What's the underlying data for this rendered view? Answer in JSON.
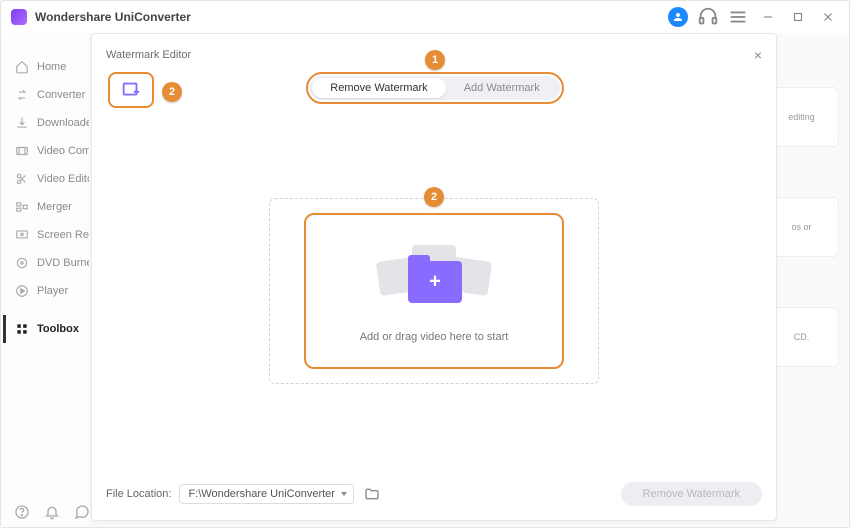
{
  "app": {
    "title": "Wondershare UniConverter"
  },
  "titlebar_icons": {
    "avatar": "user-avatar",
    "support": "headset-icon",
    "menu": "hamburger-icon",
    "minimize": "minimize-icon",
    "maximize": "maximize-icon",
    "close": "close-icon"
  },
  "sidebar": {
    "items": [
      {
        "label": "Home"
      },
      {
        "label": "Converter"
      },
      {
        "label": "Downloader"
      },
      {
        "label": "Video Compressor"
      },
      {
        "label": "Video Editor"
      },
      {
        "label": "Merger"
      },
      {
        "label": "Screen Recorder"
      },
      {
        "label": "DVD Burner"
      },
      {
        "label": "Player"
      },
      {
        "label": "Toolbox"
      }
    ],
    "active_index": 9
  },
  "background_cards": [
    {
      "text": "editing"
    },
    {
      "text": "os or"
    },
    {
      "text": "CD."
    }
  ],
  "modal": {
    "title": "Watermark Editor",
    "close": "×",
    "tabs": {
      "remove": "Remove Watermark",
      "add": "Add Watermark",
      "active": "remove"
    },
    "dropzone_text": "Add or drag video here to start",
    "footer": {
      "label": "File Location:",
      "path": "F:\\Wondershare UniConverter",
      "action": "Remove Watermark"
    }
  },
  "annotations": {
    "tab_badge": "1",
    "addfile_badge": "2",
    "dropzone_badge": "2"
  }
}
